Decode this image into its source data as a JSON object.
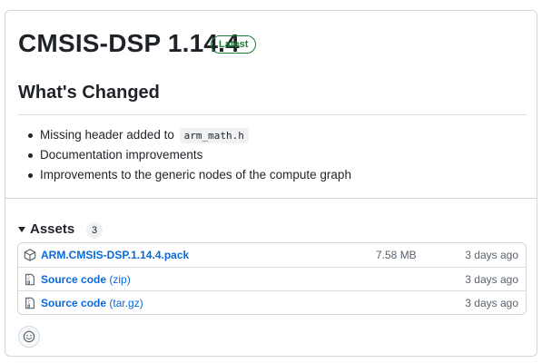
{
  "release": {
    "title": "CMSIS-DSP 1.14.4",
    "badge": "Latest"
  },
  "changes": {
    "heading": "What's Changed",
    "items": [
      {
        "text": "Missing header added to ",
        "code": "arm_math.h"
      },
      {
        "text": "Documentation improvements"
      },
      {
        "text": "Improvements to the generic nodes of the compute graph"
      }
    ]
  },
  "assets": {
    "title": "Assets",
    "count": "3",
    "rows": [
      {
        "icon": "package-icon",
        "name": "ARM.CMSIS-DSP.1.14.4.pack",
        "ext": "",
        "size": "7.58 MB",
        "date": "3 days ago"
      },
      {
        "icon": "file-zip-icon",
        "name": "Source code",
        "ext": " (zip)",
        "size": "",
        "date": "3 days ago"
      },
      {
        "icon": "file-zip-icon",
        "name": "Source code",
        "ext": " (tar.gz)",
        "size": "",
        "date": "3 days ago"
      }
    ]
  },
  "reactions": {
    "icon": "smiley-icon"
  },
  "colors": {
    "link": "#0969da",
    "latest_badge": "#1a7f37",
    "border": "#d0d7de",
    "muted_text": "#59636e"
  }
}
